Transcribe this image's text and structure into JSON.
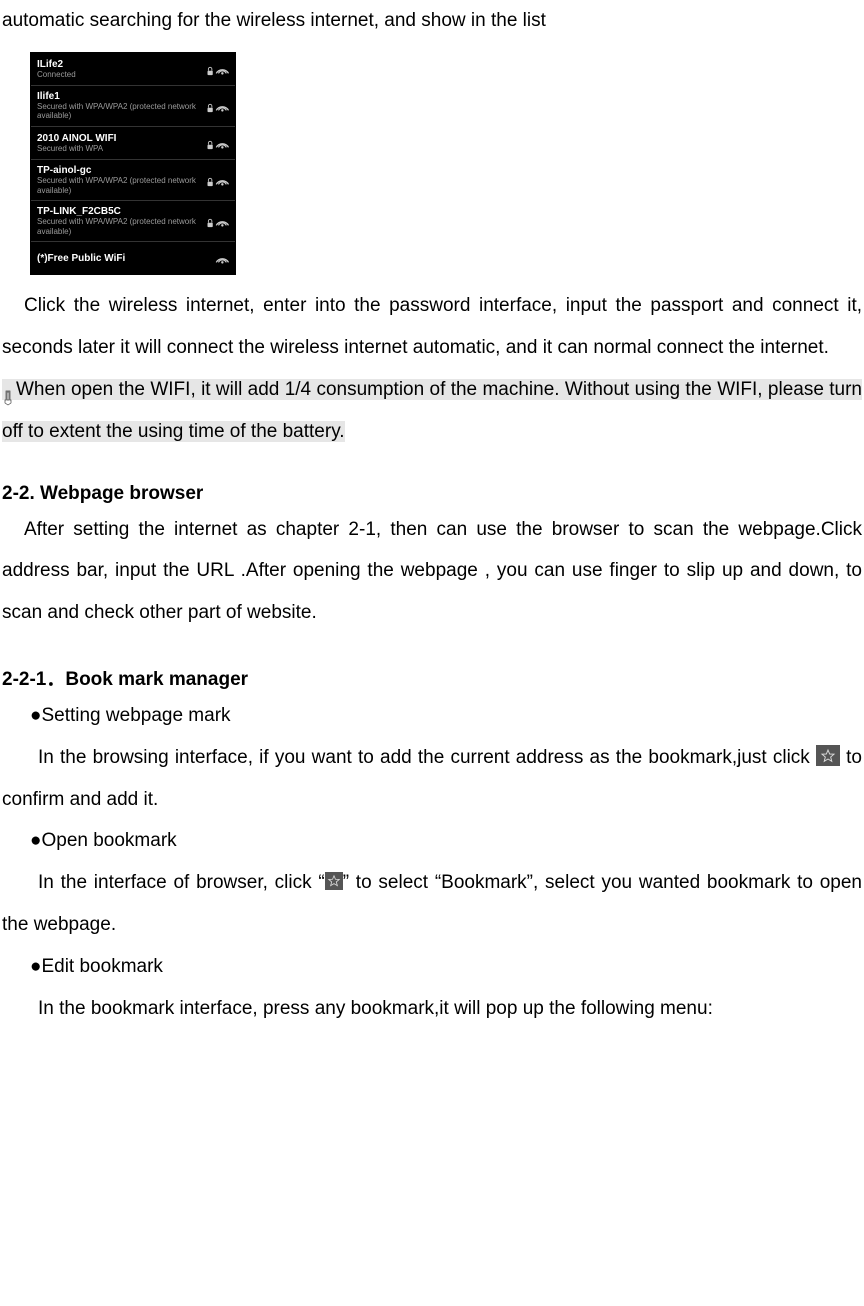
{
  "intro_line": "automatic searching for the wireless internet, and show in the list",
  "wifi_list": [
    {
      "name": "ILife2",
      "sub": "Connected",
      "lock": true
    },
    {
      "name": "Ilife1",
      "sub": "Secured with WPA/WPA2 (protected network available)",
      "lock": true
    },
    {
      "name": "2010 AINOL WIFI",
      "sub": "Secured with WPA",
      "lock": true
    },
    {
      "name": "TP-ainol-gc",
      "sub": "Secured with WPA/WPA2 (protected network available)",
      "lock": true
    },
    {
      "name": "TP-LINK_F2CB5C",
      "sub": "Secured with WPA/WPA2 (protected network available)",
      "lock": true
    },
    {
      "name": "(*)Free Public WiFi",
      "sub": "",
      "lock": false
    }
  ],
  "para_after_list": "Click the wireless internet, enter into the password interface, input the passport and connect it, seconds later it will connect the wireless internet automatic, and it can normal connect the internet.",
  "note_hl": "When open the WIFI, it will add 1/4 consumption of the machine. Without using the WIFI, please turn off to extent the using time of the battery.",
  "h_22": "2-2. Webpage browser",
  "p_22": "After setting the internet as chapter 2-1, then can use the browser to scan the webpage.Click address bar, input the URL .After opening the webpage , you can use finger to slip up and down, to scan and check other part of website.",
  "h_221": "2-2-1．Book mark manager",
  "b1_title": "●Setting webpage mark",
  "b1_text_a": "In the browsing interface, if you want to add the current address as the bookmark,just click ",
  "b1_text_b": " to confirm and add it.",
  "b2_title": "●Open bookmark",
  "b2_text_a": "In the interface of browser, click “",
  "b2_text_b": "” to select “Bookmark”, select you wanted bookmark to open the webpage.",
  "b3_title": "●Edit bookmark",
  "b3_text": "In the bookmark interface, press any bookmark,it will pop up the following menu:"
}
